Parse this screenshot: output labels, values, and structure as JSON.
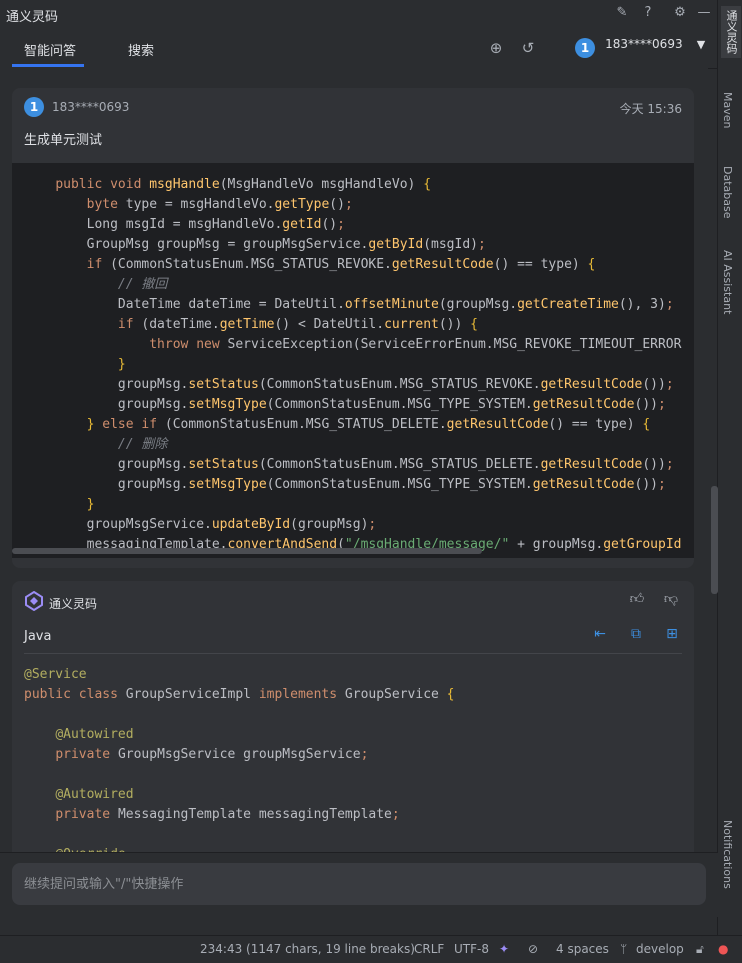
{
  "window": {
    "title": "通义灵码"
  },
  "tabs": [
    {
      "label": "智能问答"
    },
    {
      "label": "搜索"
    }
  ],
  "user": {
    "avatar_text": "1",
    "name": "183****0693"
  },
  "right_strip": {
    "items": [
      "通义灵码",
      "Maven",
      "Database",
      "AI Assistant",
      "Notifications"
    ]
  },
  "message_user": {
    "avatar_text": "1",
    "name": "183****0693",
    "time": "今天 15:36",
    "prompt": "生成单元测试"
  },
  "message_ai": {
    "name": "通义灵码",
    "language": "Java"
  },
  "input": {
    "placeholder": "继续提问或输入\"/\"快捷操作"
  },
  "statusbar": {
    "position": "234:43 (1147 chars, 19 line breaks)",
    "line_sep": "CRLF",
    "encoding": "UTF-8",
    "indent": "4 spaces",
    "branch": "develop"
  },
  "colors": {
    "accent": "#3574f0",
    "avatar": "#3d8fe0",
    "background": "#2b2d30",
    "code_bg": "#1e1f22"
  }
}
